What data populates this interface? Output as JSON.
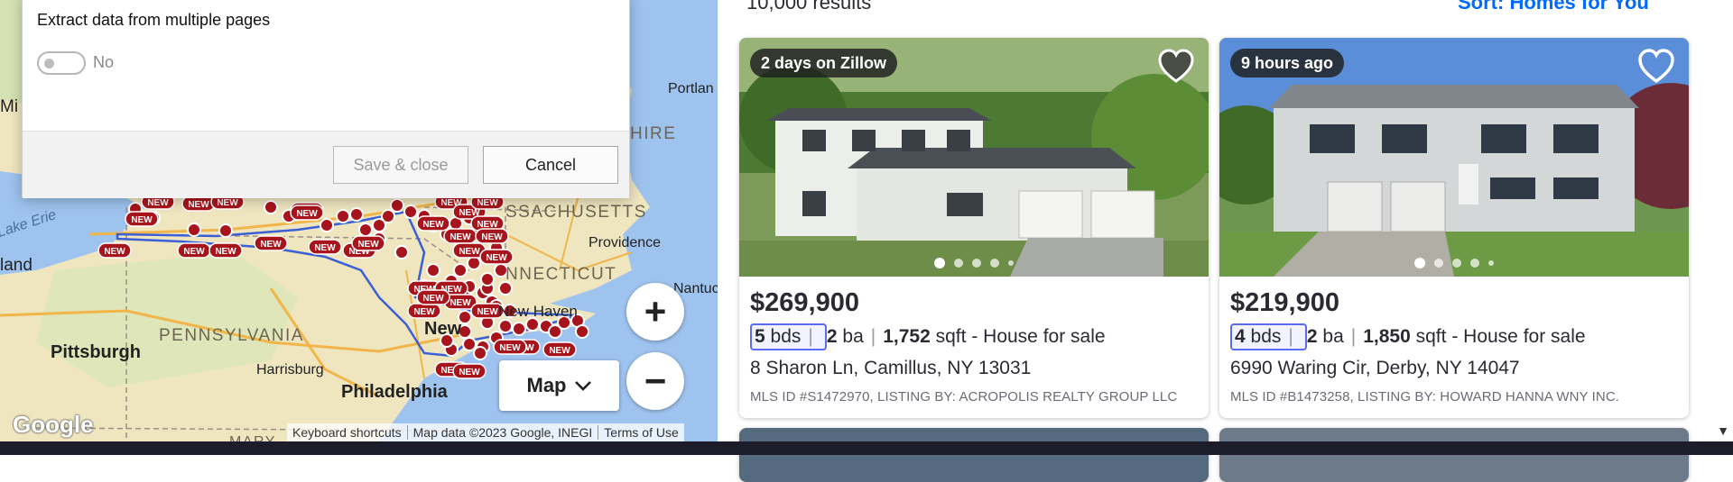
{
  "dialog": {
    "title": "Extract data from multiple pages",
    "toggle_label": "No",
    "save_label": "Save & close",
    "cancel_label": "Cancel"
  },
  "map": {
    "labels": {
      "massachusetts": "SSACHUSETTS",
      "connecticut": "NNECTICUT",
      "pennsylvania": "PENNSYLVANIA",
      "new_york_partial": "New",
      "portland": "Portlan",
      "hire": "HIRE",
      "providence": "Providence",
      "new_haven": "New Haven",
      "nantucket": "Nantuc",
      "pittsburgh": "Pittsburgh",
      "harrisburg": "Harrisburg",
      "philadelphia": "Philadelphia",
      "lake_erie": "Lake Erie",
      "mi": "Mi",
      "land": "land",
      "mary": "MARY"
    },
    "marker_label": "NEW",
    "zoom_in": "+",
    "zoom_out": "−",
    "map_type_label": "Map",
    "google": "Google",
    "attribution": {
      "keyboard": "Keyboard shortcuts",
      "data": "Map data ©2023 Google, INEGI",
      "terms": "Terms of Use"
    }
  },
  "results": {
    "count_partial": "10,000 results",
    "sort_label": "Sort: Homes for You",
    "listings": [
      {
        "badge": "2 days on Zillow",
        "price": "$269,900",
        "beds": "5",
        "beds_unit": "bds",
        "baths": "2",
        "baths_unit": "ba",
        "sqft": "1,752",
        "sqft_unit": "sqft",
        "type": "- House for sale",
        "address": "8 Sharon Ln, Camillus, NY 13031",
        "mls": "MLS ID #S1472970, LISTING BY: ACROPOLIS REALTY GROUP LLC",
        "saved": true
      },
      {
        "badge": "9 hours ago",
        "price": "$219,900",
        "beds": "4",
        "beds_unit": "bds",
        "baths": "2",
        "baths_unit": "ba",
        "sqft": "1,850",
        "sqft_unit": "sqft",
        "type": "- House for sale",
        "address": "6990 Waring Cir, Derby, NY 14047",
        "mls": "MLS ID #B1473258, LISTING BY: HOWARD HANNA WNY INC.",
        "saved": false
      }
    ]
  },
  "colors": {
    "accent": "#006aff",
    "highlight": "#5b6cf2",
    "marker": "#a8141b"
  }
}
